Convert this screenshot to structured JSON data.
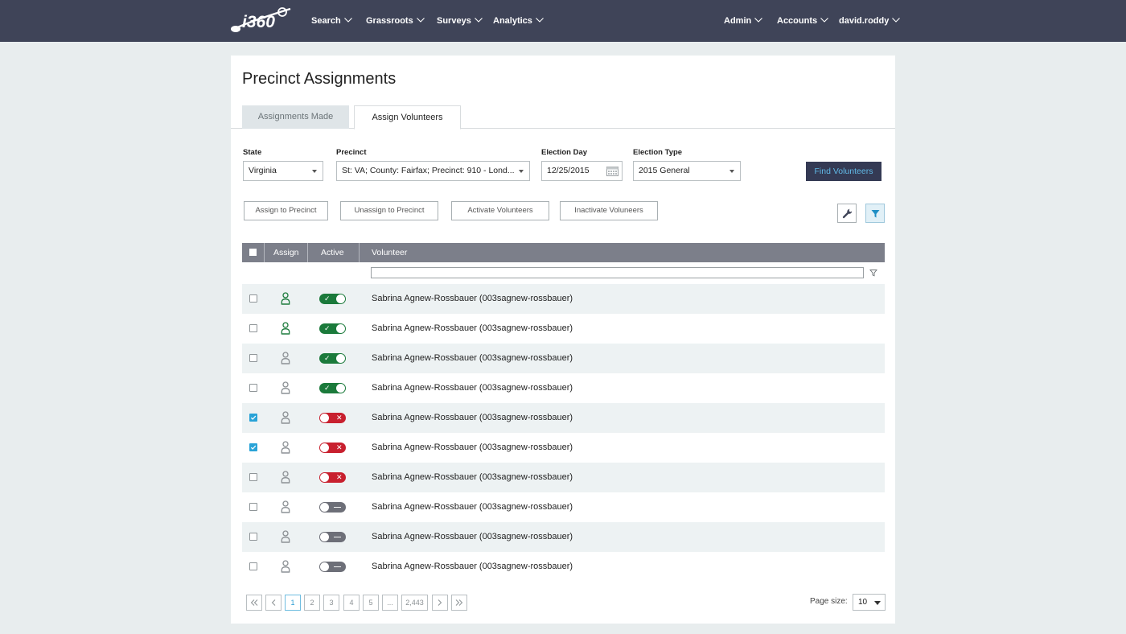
{
  "app": {
    "logo_text": "i360",
    "colors": {
      "nav_bg": "#3f4458",
      "accent": "#29a3d7",
      "active_green": "#1b7a3b",
      "inactive_red": "#c8202e",
      "neutral_toggle": "#6d6f78"
    }
  },
  "nav": {
    "left": [
      {
        "label": "Search"
      },
      {
        "label": "Grassroots"
      },
      {
        "label": "Surveys"
      },
      {
        "label": "Analytics"
      }
    ],
    "right": [
      {
        "label": "Admin"
      },
      {
        "label": "Accounts"
      },
      {
        "label": "david.roddy"
      }
    ]
  },
  "page": {
    "title": "Precinct Assignments"
  },
  "tabs": [
    {
      "label": "Assignments Made",
      "active": false
    },
    {
      "label": "Assign Volunteers",
      "active": true
    }
  ],
  "filters": {
    "state": {
      "label": "State",
      "value": "Virginia"
    },
    "precinct": {
      "label": "Precinct",
      "value": "St: VA; County: Fairfax; Precinct: 910 - Lond..."
    },
    "election_day": {
      "label": "Election Day",
      "value": "12/25/2015",
      "icon": "calendar-icon"
    },
    "election_type": {
      "label": "Election Type",
      "value": "2015 General"
    },
    "find_button": "Find Volunteers"
  },
  "actions": {
    "assign": "Assign to Precinct",
    "unassign": "Unassign to Precinct",
    "activate": "Activate Volunteers",
    "inactivate": "Inactivate Voluneers",
    "tools": [
      "wrench-icon",
      "filter-icon"
    ]
  },
  "grid": {
    "columns": {
      "assign": "Assign",
      "active": "Active",
      "volunteer": "Volunteer"
    },
    "volunteer_filter": "",
    "rows": [
      {
        "checked": false,
        "assigned": true,
        "active": "on",
        "name": "Sabrina Agnew-Rossbauer (003sagnew-rossbauer)"
      },
      {
        "checked": false,
        "assigned": true,
        "active": "on",
        "name": "Sabrina Agnew-Rossbauer (003sagnew-rossbauer)"
      },
      {
        "checked": false,
        "assigned": false,
        "active": "on",
        "name": "Sabrina Agnew-Rossbauer (003sagnew-rossbauer)"
      },
      {
        "checked": false,
        "assigned": false,
        "active": "on",
        "name": "Sabrina Agnew-Rossbauer (003sagnew-rossbauer)"
      },
      {
        "checked": true,
        "assigned": false,
        "active": "off",
        "name": "Sabrina Agnew-Rossbauer (003sagnew-rossbauer)"
      },
      {
        "checked": true,
        "assigned": false,
        "active": "off",
        "name": "Sabrina Agnew-Rossbauer (003sagnew-rossbauer)"
      },
      {
        "checked": false,
        "assigned": false,
        "active": "off",
        "name": "Sabrina Agnew-Rossbauer (003sagnew-rossbauer)"
      },
      {
        "checked": false,
        "assigned": false,
        "active": "neutral",
        "name": "Sabrina Agnew-Rossbauer (003sagnew-rossbauer)"
      },
      {
        "checked": false,
        "assigned": false,
        "active": "neutral",
        "name": "Sabrina Agnew-Rossbauer (003sagnew-rossbauer)"
      },
      {
        "checked": false,
        "assigned": false,
        "active": "neutral",
        "name": "Sabrina Agnew-Rossbauer (003sagnew-rossbauer)"
      }
    ]
  },
  "pager": {
    "first": "first-page-icon",
    "prev": "prev-page-icon",
    "pages": [
      "1",
      "2",
      "3",
      "4",
      "5",
      "...",
      "2,443"
    ],
    "current": "1",
    "next": "next-page-icon",
    "last": "last-page-icon",
    "page_size_label": "Page size:",
    "page_size": "10"
  }
}
